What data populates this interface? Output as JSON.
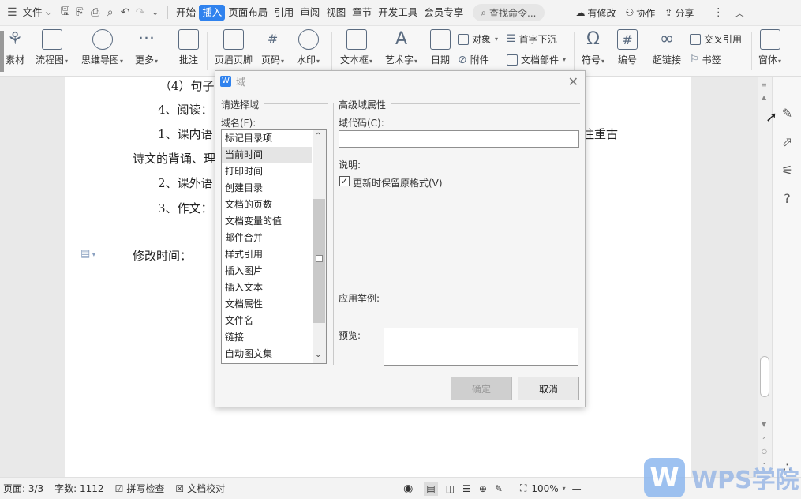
{
  "menubar": {
    "file_label": "文件",
    "tabs": [
      "开始",
      "插入",
      "页面布局",
      "引用",
      "审阅",
      "视图",
      "章节",
      "开发工具",
      "会员专享"
    ],
    "active_tab": "插入",
    "search_placeholder": "查找命令...",
    "modified_label": "有修改",
    "collab_label": "协作",
    "share_label": "分享"
  },
  "ribbon": {
    "material": "素材",
    "flowchart": "流程图",
    "mindmap": "思维导图",
    "more": "更多",
    "comment": "批注",
    "header_footer": "页眉页脚",
    "page_number": "页码",
    "watermark": "水印",
    "textbox": "文本框",
    "wordart": "艺术字",
    "date": "日期",
    "object": "对象",
    "dropcap": "首字下沉",
    "attachment": "附件",
    "docparts": "文档部件",
    "symbol": "符号",
    "numbering": "编号",
    "hyperlink": "超链接",
    "crossref": "交叉引用",
    "bookmark": "书签",
    "window": "窗体"
  },
  "document": {
    "line1": "（4）句子",
    "line2": "4、阅读：",
    "line3a": "1、课内语",
    "line3b": "注重古",
    "line4": "诗文的背诵、理",
    "line5": "2、课外语",
    "line6": "3、作文：",
    "line7": "修改时间："
  },
  "dialog": {
    "title": "域",
    "select_group": "请选择域",
    "field_name_label": "域名(F):",
    "items": [
      "标记目录项",
      "当前时间",
      "打印时间",
      "创建目录",
      "文档的页数",
      "文档变量的值",
      "邮件合并",
      "样式引用",
      "插入图片",
      "插入文本",
      "文档属性",
      "文件名",
      "链接",
      "自动图文集"
    ],
    "selected_item": "当前时间",
    "advanced_group": "高级域属性",
    "field_code_label": "域代码(C):",
    "field_code_value": "",
    "description_label": "说明:",
    "preserve_format_label": "更新时保留原格式(V)",
    "preserve_format_checked": true,
    "example_label": "应用举例:",
    "preview_label": "预览:",
    "ok_label": "确定",
    "cancel_label": "取消"
  },
  "statusbar": {
    "page": "页面: 3/3",
    "words": "字数: 1112",
    "spellcheck": "拼写检查",
    "proofread": "文档校对",
    "zoom": "100%"
  },
  "watermark": {
    "logo_letter": "W",
    "text": "WPS学院"
  },
  "colors": {
    "accent": "#2f82ee",
    "ribbon_bg": "#f7f7f7",
    "dialog_bg": "#f5f5f5"
  }
}
